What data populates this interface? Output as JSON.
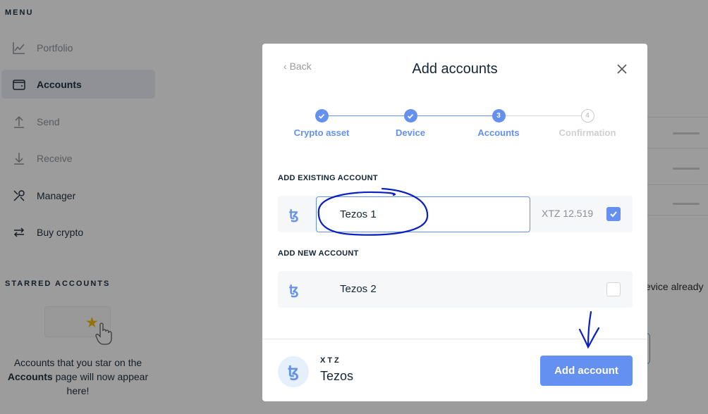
{
  "sidebar": {
    "menu_title": "MENU",
    "items": [
      {
        "label": "Portfolio",
        "icon": "chart-icon"
      },
      {
        "label": "Accounts",
        "icon": "wallet-icon"
      },
      {
        "label": "Send",
        "icon": "arrow-up-icon"
      },
      {
        "label": "Receive",
        "icon": "arrow-down-icon"
      },
      {
        "label": "Manager",
        "icon": "tools-icon"
      },
      {
        "label": "Buy crypto",
        "icon": "exchange-icon"
      }
    ],
    "starred_title": "STARRED ACCOUNTS",
    "starred_text_pre": "Accounts that you star on the",
    "starred_text_bold": "Accounts",
    "starred_text_post": "page will now appear here!"
  },
  "background": {
    "partial_text": "evice already"
  },
  "modal": {
    "back_label": "Back",
    "title": "Add accounts",
    "steps": [
      {
        "label": "Crypto asset",
        "state": "done"
      },
      {
        "label": "Device",
        "state": "done"
      },
      {
        "label": "Accounts",
        "state": "current",
        "number": "3"
      },
      {
        "label": "Confirmation",
        "state": "pending",
        "number": "4"
      }
    ],
    "existing_section_label": "ADD EXISTING ACCOUNT",
    "existing_account": {
      "name": "Tezos 1",
      "balance": "XTZ 12.519",
      "checked": true
    },
    "new_section_label": "ADD NEW ACCOUNT",
    "new_account": {
      "name": "Tezos 2",
      "checked": false
    },
    "currency_glyph": "ꜩ",
    "footer": {
      "ticker": "XTZ",
      "name": "Tezos",
      "add_button": "Add account"
    }
  },
  "colors": {
    "accent": "#6490f1",
    "text": "#142533",
    "muted": "#8a8f95",
    "annotation": "#0a1fc4"
  }
}
